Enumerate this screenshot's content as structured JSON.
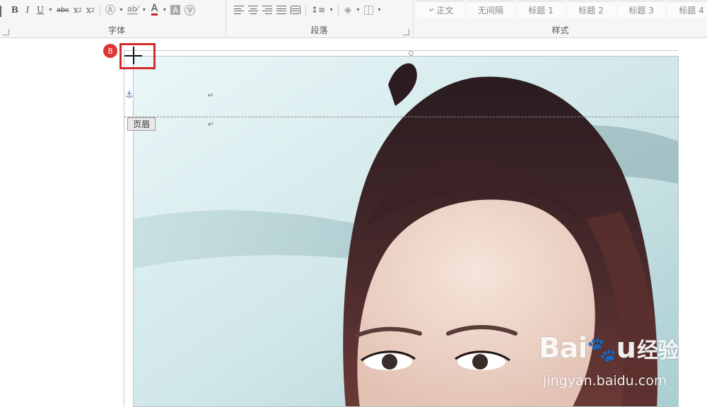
{
  "ribbon": {
    "font_group": {
      "label": "字体",
      "buttons": {
        "bold": "B",
        "italic": "I",
        "underline": "U",
        "strike": "abc",
        "subscript": "x",
        "subscript_mark": "2",
        "superscript": "x",
        "superscript_mark": "2"
      }
    },
    "paragraph_group": {
      "label": "段落"
    },
    "styles_group": {
      "label": "样式",
      "items": [
        "正文",
        "无间隔",
        "标题 1",
        "标题 2",
        "标题 3",
        "标题 4"
      ]
    }
  },
  "document": {
    "header_tag": "页眉",
    "paragraph_mark": "↵"
  },
  "annotation": {
    "step_number": "8",
    "color": "#d42a2a"
  },
  "colors": {
    "font_color_bar": "#d02020",
    "anchor": "#4a78b0",
    "header_line": "#8a8a8a"
  }
}
